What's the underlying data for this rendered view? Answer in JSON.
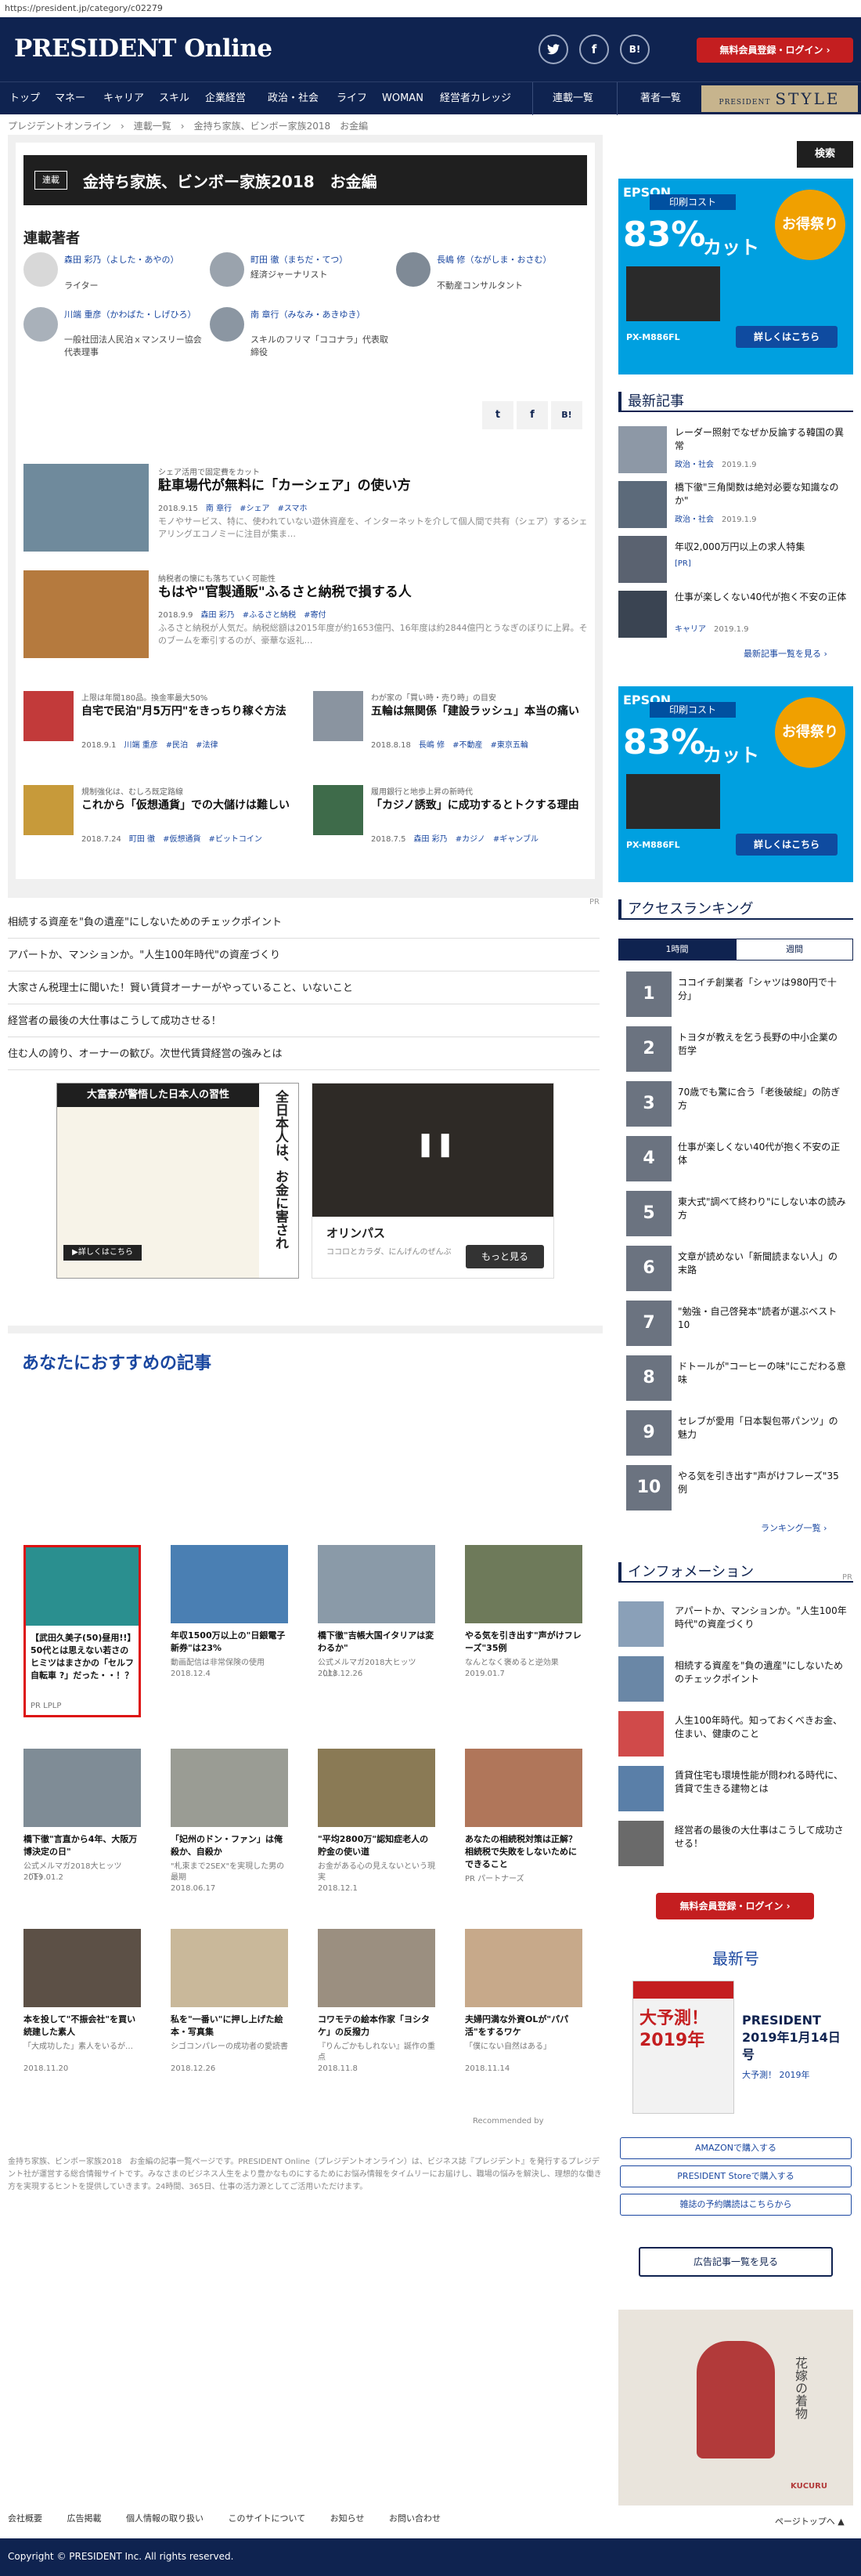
{
  "browser": {
    "url": "https://president.jp/category/c02279"
  },
  "header": {
    "logo": "PRESIDENT Online",
    "social": [
      "twitter-icon",
      "facebook-icon",
      "hatena-icon"
    ],
    "hatena_label": "B!",
    "facebook_label": "f",
    "register_label": "無料会員登録・ログイン ›"
  },
  "nav": {
    "items": [
      "トップ",
      "マネー",
      "キャリア",
      "スキル",
      "企業経営",
      "政治・社会",
      "ライフ",
      "WOMAN",
      "経営者カレッジ",
      "連載一覧",
      "著者一覧"
    ],
    "style_small": "PRESIDENT",
    "style_label": "STYLE"
  },
  "breadcrumb": "プレジデントオンライン　›　連載一覧　›　金持ち家族、ビンボー家族2018　お金編",
  "series": {
    "badge": "連載",
    "title": "金持ち家族、ビンボー家族2018　お金編",
    "authors_heading": "連載著者",
    "authors": [
      {
        "name": "森田 彩乃（よした・あやの）",
        "role": "ライター"
      },
      {
        "name": "町田 徹（まちだ・てつ）",
        "role": "経済ジャーナリスト"
      },
      {
        "name": "長嶋 修（ながしま・おさむ）",
        "role": "不動産コンサルタント"
      },
      {
        "name": "川端 重彦（かわばた・しげひろ）",
        "role": "一般社団法人民泊ｘマンスリー協会代表理事"
      },
      {
        "name": "南 章行（みなみ・あきゆき）",
        "role": "スキルのフリマ「ココナラ」代表取締役"
      }
    ],
    "share": [
      "twitter-icon",
      "facebook-icon",
      "hatena-icon"
    ]
  },
  "articles_wide": [
    {
      "sub": "シェア活用で固定費をカット",
      "title": "駐車場代が無料に「カーシェア」の使い方",
      "date": "2018.9.15",
      "author": "南 章行",
      "tags": "#シェア　#スマホ",
      "desc": "モノやサービス、特に、使われていない遊休資産を、インターネットを介して個人間で共有（シェア）するシェアリングエコノミーに注目が集ま…"
    },
    {
      "sub": "納税者の懐にも落ちていく可能性",
      "title": "もはや\"官製通販\"ふるさと納税で損する人",
      "date": "2018.9.9",
      "author": "森田 彩乃",
      "tags": "#ふるさと納税　#寄付",
      "desc": "ふるさと納税が人気だ。納税総額は2015年度が約1653億円、16年度は約2844億円とうなぎのぼりに上昇。そのブームを牽引するのが、豪華な返礼…"
    }
  ],
  "articles_small": [
    {
      "sub": "上限は年間180品。換金率最大50%",
      "title": "自宅で民泊\"月5万円\"をきっちり稼ぐ方法",
      "date": "2018.9.1",
      "author": "川端 重彦",
      "tags": "#民泊　#法律"
    },
    {
      "sub": "わが家の「買い時・売り時」の目安",
      "title": "五輪は無関係「建設ラッシュ」本当の痛い",
      "date": "2018.8.18",
      "author": "長嶋 修",
      "tags": "#不動産　#東京五輪"
    },
    {
      "sub": "規制強化は、むしろ既定路線",
      "title": "これから「仮想通貨」での大儲けは難しい",
      "date": "2018.7.24",
      "author": "町田 徹",
      "tags": "#仮想通貨　#ビットコイン"
    },
    {
      "sub": "履用銀行と地歩上昇の新時代",
      "title": "「カジノ誘致」に成功するとトクする理由",
      "date": "2018.7.5",
      "author": "森田 彩乃",
      "tags": "#カジノ　#ギャンブル"
    }
  ],
  "pr_label": "PR",
  "pr_links": [
    "相続する資産を\"負の遺産\"にしないためのチェックポイント",
    "アパートか、マンションか。\"人生100年時代\"の資産づくり",
    "大家さん税理士に聞いた！賢い賃貸オーナーがやっていること、いないこと",
    "経営者の最後の大仕事はこうして成功させる！",
    "住む人の誇り、オーナーの歓び。次世代賃貸経営の強みとは"
  ],
  "ad_book": {
    "banner": "大富豪が警悟した日本人の習性",
    "side": "全日本人は、お金に害され",
    "btn": "▶詳しくはこちら"
  },
  "ad_video": {
    "brand": "オリンパス",
    "text": "ココロとカラダ、にんげんのぜんぶ",
    "btn": "もっと見る"
  },
  "recommend": {
    "heading": "あなたにおすすめの記事",
    "items": [
      {
        "title": "【武田久美子(50)昼用!!】50代とは思えない若さのヒミツはまさかの「セルフ自転車 ?」だった・・！？",
        "src": "PR LPLP"
      },
      {
        "title": "年収1500万以上の\"日銀電子新券\"は23%",
        "src": "動画配信は非常保険の使用",
        "date": "2018.12.4"
      },
      {
        "title": "橋下徹\"吉帳大国イタリアは変わるか\"",
        "src": "公式メルマガ2018大ヒッツ（上）",
        "date": "2018.12.26"
      },
      {
        "title": "やる気を引き出す\"声がけフレーズ\"35例",
        "src": "なんとなく褒めると逆効果",
        "date": "2019.01.7"
      },
      {
        "title": "橋下徹\"言直から4年、大阪万博決定の日\"",
        "src": "公式メルマガ2018大ヒッツ（下）",
        "date": "2019.01.2"
      },
      {
        "title": "「妃州のドン・ファン」は俺殺か、自殺か",
        "src": "\"札束まで2SEX\"を実現した男の最期",
        "date": "2018.06.17"
      },
      {
        "title": "\"平均2800万\"認知症老人の貯金の使い道",
        "src": "お金がある心の見えないという現実",
        "date": "2018.12.1"
      },
      {
        "title": "あなたの相続税対策は正解？相続税で失敗をしないためにできること",
        "src": "PR パートナーズ"
      },
      {
        "title": "本を投して\"不振会社\"を買い続建した素人",
        "src": "「大成功した」素人をいるが…",
        "date": "2018.11.20"
      },
      {
        "title": "私を\"一番い\"に押し上げた絵本・写真集",
        "src": "シゴコンパレーの成功者の愛読書",
        "date": "2018.12.26"
      },
      {
        "title": "コワモテの絵本作家「ヨシタケ」の反撥力",
        "src": "『りんごかもしれない』誕作の重点",
        "date": "2018.11.8"
      },
      {
        "title": "夫婦円満な外資OLが\"パパ活\"をするワケ",
        "src": "「僕にない自然はある」",
        "date": "2018.11.14"
      }
    ],
    "attribution": "Recommended by"
  },
  "sidebar": {
    "search_label": "検索",
    "ad_brand": "EPSON",
    "ad_cost": "印刷コスト",
    "ad_pct": "83%",
    "ad_cut": "カット",
    "ad_deal": "お得祭り",
    "ad_model": "PX-M886FL",
    "ad_btn": "詳しくはこちら",
    "latest_heading": "最新記事",
    "latest": [
      {
        "title": "レーダー照射でなぜか反論する韓国の異常",
        "cat": "政治・社会",
        "date": "2019.1.9"
      },
      {
        "title": "橋下徹\"三角関数は絶対必要な知識なのか\"",
        "cat": "政治・社会",
        "date": "2019.1.9"
      },
      {
        "title": "年収2,000万円以上の求人特集",
        "cat": "[PR]",
        "date": ""
      },
      {
        "title": "仕事が楽しくない40代が抱く不安の正体",
        "cat": "キャリア",
        "date": "2019.1.9"
      }
    ],
    "latest_more": "最新記事一覧を見る ›",
    "ranking_heading": "アクセスランキング",
    "ranking_tabs": [
      "1時間",
      "週間"
    ],
    "ranking": [
      "ココイチ創業者「シャツは980円で十分」",
      "トヨタが教えを乞う長野の中小企業の哲学",
      "70歳でも驚に合う「老後破綻」の防ぎ方",
      "仕事が楽しくない40代が抱く不安の正体",
      "東大式\"調べて終わり\"にしない本の読み方",
      "文章が読めない「新聞読まない人」の末路",
      "\"勉強・自己啓発本\"読者が選ぶベスト10",
      "ドトールが\"コーヒーの味\"にこだわる意味",
      "セレブが愛用「日本製包帯パンツ」の魅力",
      "やる気を引き出す\"声がけフレーズ\"35例"
    ],
    "ranking_more": "ランキング一覧 ›",
    "info_heading": "インフォメーション",
    "info_pr": "PR",
    "info": [
      "アパートか、マンションか。\"人生100年時代\"の資産づくり",
      "相続する資産を\"負の遺産\"にしないためのチェックポイント",
      "人生100年時代。知っておくべきお金、住まい、健康のこと",
      "賃貸住宅も環境性能が問われる時代に、賃貸で生きる建物とは",
      "経営者の最後の大仕事はこうして成功させる！"
    ],
    "register_label": "無料会員登録・ログイン ›",
    "issue_heading": "最新号",
    "issue_cover": "大予測！2019年",
    "issue_title": "PRESIDENT 2019年1月14日号",
    "issue_sub": "大予測！ 2019年",
    "buy_amazon": "AMAZONで購入する",
    "buy_store": "PRESIDENT Storeで購入する",
    "buy_magazine": "雑誌の予約購読はこちらから",
    "ad_list": "広告記事一覧を見る",
    "bottom_ad_text": "花嫁の着物",
    "bottom_ad_brand": "KUCURU"
  },
  "about_text": "金持ち家族、ビンボー家族2018　お金編の記事一覧ページです。PRESIDENT Online（プレジデントオンライン）は、ビジネス誌『プレジデント』を発行するプレジデント社が運営する総合情報サイトです。みなさまのビジネス人生をより豊かなものにするためにお悩み情報をタイムリーにお届けし、職場の悩みを解決し、理想的な働き方を実現するヒントを提供していきます。24時間、365日、仕事の活力源としてご活用いただけます。",
  "footer": {
    "links": [
      "会社概要",
      "広告掲載",
      "個人情報の取り扱い",
      "このサイトについて",
      "お知らせ",
      "お問い合わせ"
    ],
    "pagetop": "ページトップへ ▲",
    "copyright": "Copyright © PRESIDENT Inc. All rights reserved."
  }
}
